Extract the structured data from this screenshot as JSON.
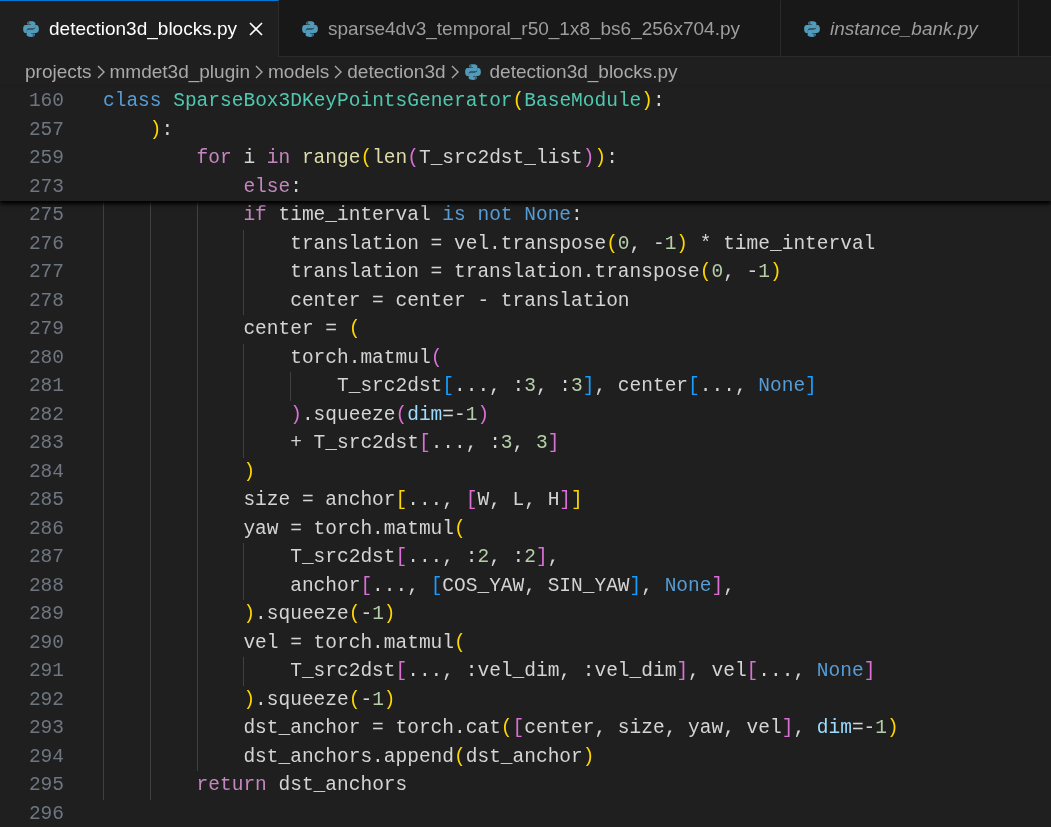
{
  "tabs": [
    {
      "label": "detection3d_blocks.py",
      "selected": true,
      "preview": false
    },
    {
      "label": "sparse4dv3_temporal_r50_1x8_bs6_256x704.py",
      "selected": false,
      "preview": false
    },
    {
      "label": "instance_bank.py",
      "selected": false,
      "preview": true
    }
  ],
  "breadcrumbs": [
    {
      "label": "projects",
      "kind": "folder"
    },
    {
      "label": "mmdet3d_plugin",
      "kind": "folder"
    },
    {
      "label": "models",
      "kind": "folder"
    },
    {
      "label": "detection3d",
      "kind": "folder"
    },
    {
      "label": "detection3d_blocks.py",
      "kind": "file"
    }
  ],
  "sticky_lines": [
    {
      "number": "160",
      "tokens": [
        {
          "kind": "keyword",
          "text": "class "
        },
        {
          "kind": "class",
          "text": "SparseBox3DKeyPointsGenerator"
        },
        {
          "kind": "bracket1",
          "text": "("
        },
        {
          "kind": "class",
          "text": "BaseModule"
        },
        {
          "kind": "bracket1",
          "text": ")"
        },
        {
          "kind": "plain",
          "text": ":"
        }
      ]
    },
    {
      "number": "257",
      "tokens": [
        {
          "kind": "bracket1",
          "text": "    )"
        },
        {
          "kind": "plain",
          "text": ":"
        }
      ]
    },
    {
      "number": "259",
      "tokens": [
        {
          "kind": "control",
          "text": "        for"
        },
        {
          "kind": "plain",
          "text": " i "
        },
        {
          "kind": "control",
          "text": "in "
        },
        {
          "kind": "function",
          "text": "range"
        },
        {
          "kind": "bracket1",
          "text": "("
        },
        {
          "kind": "function",
          "text": "len"
        },
        {
          "kind": "bracket2",
          "text": "("
        },
        {
          "kind": "plain",
          "text": "T_src2dst_list"
        },
        {
          "kind": "bracket2",
          "text": ")"
        },
        {
          "kind": "bracket1",
          "text": ")"
        },
        {
          "kind": "plain",
          "text": ":"
        }
      ]
    },
    {
      "number": "273",
      "tokens": [
        {
          "kind": "control",
          "text": "            else"
        },
        {
          "kind": "plain",
          "text": ":"
        }
      ]
    }
  ],
  "lines": [
    {
      "number": "275",
      "tokens": [
        {
          "kind": "control",
          "text": "            if"
        },
        {
          "kind": "plain",
          "text": " time_interval "
        },
        {
          "kind": "keyword",
          "text": "is not None"
        },
        {
          "kind": "plain",
          "text": ":"
        }
      ]
    },
    {
      "number": "276",
      "tokens": [
        {
          "kind": "plain",
          "text": "                translation = vel.transpose"
        },
        {
          "kind": "bracket1",
          "text": "("
        },
        {
          "kind": "number",
          "text": "0"
        },
        {
          "kind": "plain",
          "text": ", -"
        },
        {
          "kind": "number",
          "text": "1"
        },
        {
          "kind": "bracket1",
          "text": ")"
        },
        {
          "kind": "plain",
          "text": " * time_interval"
        }
      ]
    },
    {
      "number": "277",
      "tokens": [
        {
          "kind": "plain",
          "text": "                translation = translation.transpose"
        },
        {
          "kind": "bracket1",
          "text": "("
        },
        {
          "kind": "number",
          "text": "0"
        },
        {
          "kind": "plain",
          "text": ", -"
        },
        {
          "kind": "number",
          "text": "1"
        },
        {
          "kind": "bracket1",
          "text": ")"
        }
      ]
    },
    {
      "number": "278",
      "tokens": [
        {
          "kind": "plain",
          "text": "                center = center - translation"
        }
      ]
    },
    {
      "number": "279",
      "tokens": [
        {
          "kind": "plain",
          "text": "            center = "
        },
        {
          "kind": "bracket1",
          "text": "("
        }
      ]
    },
    {
      "number": "280",
      "tokens": [
        {
          "kind": "plain",
          "text": "                torch.matmul"
        },
        {
          "kind": "bracket2",
          "text": "("
        }
      ]
    },
    {
      "number": "281",
      "tokens": [
        {
          "kind": "plain",
          "text": "                    T_src2dst"
        },
        {
          "kind": "bracket3",
          "text": "["
        },
        {
          "kind": "plain",
          "text": "..., :"
        },
        {
          "kind": "number",
          "text": "3"
        },
        {
          "kind": "plain",
          "text": ", :"
        },
        {
          "kind": "number",
          "text": "3"
        },
        {
          "kind": "bracket3",
          "text": "]"
        },
        {
          "kind": "plain",
          "text": ", center"
        },
        {
          "kind": "bracket3",
          "text": "["
        },
        {
          "kind": "plain",
          "text": "..., "
        },
        {
          "kind": "keyword",
          "text": "None"
        },
        {
          "kind": "bracket3",
          "text": "]"
        }
      ]
    },
    {
      "number": "282",
      "tokens": [
        {
          "kind": "bracket2",
          "text": "                )"
        },
        {
          "kind": "plain",
          "text": ".squeeze"
        },
        {
          "kind": "bracket2",
          "text": "("
        },
        {
          "kind": "param",
          "text": "dim"
        },
        {
          "kind": "plain",
          "text": "=-"
        },
        {
          "kind": "number",
          "text": "1"
        },
        {
          "kind": "bracket2",
          "text": ")"
        }
      ]
    },
    {
      "number": "283",
      "tokens": [
        {
          "kind": "plain",
          "text": "                + T_src2dst"
        },
        {
          "kind": "bracket2",
          "text": "["
        },
        {
          "kind": "plain",
          "text": "..., :"
        },
        {
          "kind": "number",
          "text": "3"
        },
        {
          "kind": "plain",
          "text": ", "
        },
        {
          "kind": "number",
          "text": "3"
        },
        {
          "kind": "bracket2",
          "text": "]"
        }
      ]
    },
    {
      "number": "284",
      "tokens": [
        {
          "kind": "bracket1",
          "text": "            )"
        }
      ]
    },
    {
      "number": "285",
      "tokens": [
        {
          "kind": "plain",
          "text": "            size = anchor"
        },
        {
          "kind": "bracket1",
          "text": "["
        },
        {
          "kind": "plain",
          "text": "..., "
        },
        {
          "kind": "bracket2",
          "text": "["
        },
        {
          "kind": "plain",
          "text": "W, L, H"
        },
        {
          "kind": "bracket2",
          "text": "]"
        },
        {
          "kind": "bracket1",
          "text": "]"
        }
      ]
    },
    {
      "number": "286",
      "tokens": [
        {
          "kind": "plain",
          "text": "            yaw = torch.matmul"
        },
        {
          "kind": "bracket1",
          "text": "("
        }
      ]
    },
    {
      "number": "287",
      "tokens": [
        {
          "kind": "plain",
          "text": "                T_src2dst"
        },
        {
          "kind": "bracket2",
          "text": "["
        },
        {
          "kind": "plain",
          "text": "..., :"
        },
        {
          "kind": "number",
          "text": "2"
        },
        {
          "kind": "plain",
          "text": ", :"
        },
        {
          "kind": "number",
          "text": "2"
        },
        {
          "kind": "bracket2",
          "text": "]"
        },
        {
          "kind": "plain",
          "text": ","
        }
      ]
    },
    {
      "number": "288",
      "tokens": [
        {
          "kind": "plain",
          "text": "                anchor"
        },
        {
          "kind": "bracket2",
          "text": "["
        },
        {
          "kind": "plain",
          "text": "..., "
        },
        {
          "kind": "bracket3",
          "text": "["
        },
        {
          "kind": "plain",
          "text": "COS_YAW, SIN_YAW"
        },
        {
          "kind": "bracket3",
          "text": "]"
        },
        {
          "kind": "plain",
          "text": ", "
        },
        {
          "kind": "keyword",
          "text": "None"
        },
        {
          "kind": "bracket2",
          "text": "]"
        },
        {
          "kind": "plain",
          "text": ","
        }
      ]
    },
    {
      "number": "289",
      "tokens": [
        {
          "kind": "bracket1",
          "text": "            )"
        },
        {
          "kind": "plain",
          "text": ".squeeze"
        },
        {
          "kind": "bracket1",
          "text": "("
        },
        {
          "kind": "plain",
          "text": "-"
        },
        {
          "kind": "number",
          "text": "1"
        },
        {
          "kind": "bracket1",
          "text": ")"
        }
      ]
    },
    {
      "number": "290",
      "tokens": [
        {
          "kind": "plain",
          "text": "            vel = torch.matmul"
        },
        {
          "kind": "bracket1",
          "text": "("
        }
      ]
    },
    {
      "number": "291",
      "tokens": [
        {
          "kind": "plain",
          "text": "                T_src2dst"
        },
        {
          "kind": "bracket2",
          "text": "["
        },
        {
          "kind": "plain",
          "text": "..., :vel_dim, :vel_dim"
        },
        {
          "kind": "bracket2",
          "text": "]"
        },
        {
          "kind": "plain",
          "text": ", vel"
        },
        {
          "kind": "bracket2",
          "text": "["
        },
        {
          "kind": "plain",
          "text": "..., "
        },
        {
          "kind": "keyword",
          "text": "None"
        },
        {
          "kind": "bracket2",
          "text": "]"
        }
      ]
    },
    {
      "number": "292",
      "tokens": [
        {
          "kind": "bracket1",
          "text": "            )"
        },
        {
          "kind": "plain",
          "text": ".squeeze"
        },
        {
          "kind": "bracket1",
          "text": "("
        },
        {
          "kind": "plain",
          "text": "-"
        },
        {
          "kind": "number",
          "text": "1"
        },
        {
          "kind": "bracket1",
          "text": ")"
        }
      ]
    },
    {
      "number": "293",
      "tokens": [
        {
          "kind": "plain",
          "text": "            dst_anchor = torch.cat"
        },
        {
          "kind": "bracket1",
          "text": "("
        },
        {
          "kind": "bracket2",
          "text": "["
        },
        {
          "kind": "plain",
          "text": "center, size, yaw, vel"
        },
        {
          "kind": "bracket2",
          "text": "]"
        },
        {
          "kind": "plain",
          "text": ", "
        },
        {
          "kind": "param",
          "text": "dim"
        },
        {
          "kind": "plain",
          "text": "=-"
        },
        {
          "kind": "number",
          "text": "1"
        },
        {
          "kind": "bracket1",
          "text": ")"
        }
      ]
    },
    {
      "number": "294",
      "tokens": [
        {
          "kind": "plain",
          "text": "            dst_anchors.append"
        },
        {
          "kind": "bracket1",
          "text": "("
        },
        {
          "kind": "plain",
          "text": "dst_anchor"
        },
        {
          "kind": "bracket1",
          "text": ")"
        }
      ]
    },
    {
      "number": "295",
      "tokens": [
        {
          "kind": "control",
          "text": "        return"
        },
        {
          "kind": "plain",
          "text": " dst_anchors"
        }
      ]
    },
    {
      "number": "296"
    }
  ]
}
